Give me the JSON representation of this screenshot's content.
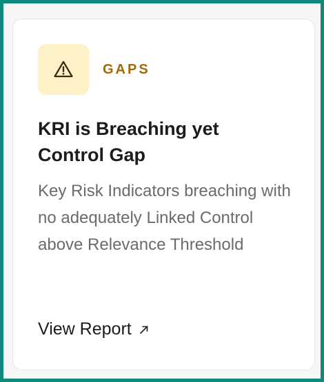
{
  "card": {
    "category": "GAPS",
    "title": "KRI is Breaching yet Control Gap",
    "description": "Key Risk Indicators breaching with no adequately Linked Control above Relevance Threshold",
    "action_label": "View Report",
    "icon": "warning-triangle-icon",
    "action_icon": "arrow-up-right-icon"
  },
  "colors": {
    "frame_border": "#0e8a7d",
    "icon_background": "#fdf1c8",
    "category_text": "#a06a06",
    "title_text": "#1c1c1c",
    "description_text": "#6b6b6b"
  }
}
